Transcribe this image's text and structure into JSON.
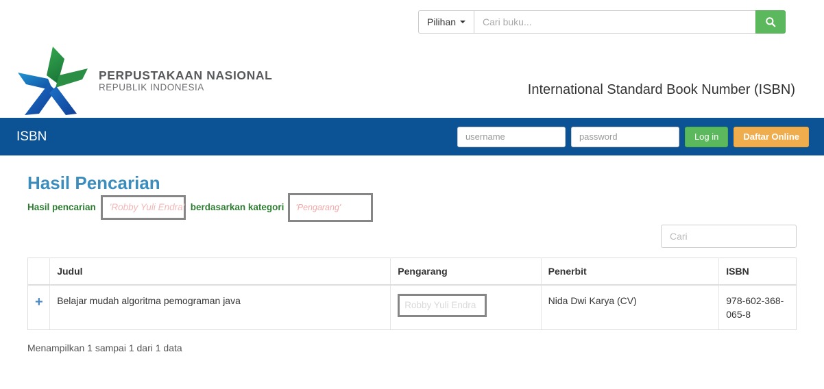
{
  "topbar": {
    "dropdown_label": "Pilihan",
    "search_placeholder": "Cari buku...",
    "search_value": "",
    "search_icon": "search-icon"
  },
  "brand": {
    "logo_line1": "PERPUSTAKAAN NASIONAL",
    "logo_line2": "REPUBLIK INDONESIA",
    "page_heading": "International Standard Book Number (ISBN)",
    "logo_green": "#2e9e4a",
    "logo_blue": "#1565c0",
    "logo_teal": "#2196d3"
  },
  "navbar": {
    "brand": "ISBN",
    "username_placeholder": "username",
    "username_value": "",
    "password_placeholder": "password",
    "password_value": "",
    "login_label": "Log in",
    "register_label": "Daftar Online",
    "bg_color": "#0b5394",
    "login_color": "#5cb85c",
    "register_color": "#f0ad4e"
  },
  "main": {
    "title": "Hasil Pencarian",
    "subtitle_prefix": "Hasil pencarian",
    "keyword": "'Robby Yuli Endra'",
    "subtitle_middle": "berdasarkan kategori",
    "category": "'Pengarang'",
    "title_color": "#3c8dbc",
    "subtitle_color": "#2e7d32"
  },
  "table": {
    "search_placeholder": "Cari",
    "search_value": "",
    "expand_icon": "plus-icon",
    "columns": [
      "",
      "Judul",
      "Pengarang",
      "Penerbit",
      "ISBN"
    ],
    "rows": [
      {
        "judul": "Belajar mudah algoritma pemograman java",
        "pengarang": "Robby Yuli Endra",
        "penerbit": "Nida Dwi Karya (CV)",
        "isbn": "978-602-368-065-8"
      }
    ],
    "info": "Menampilkan 1 sampai 1 dari 1 data"
  }
}
